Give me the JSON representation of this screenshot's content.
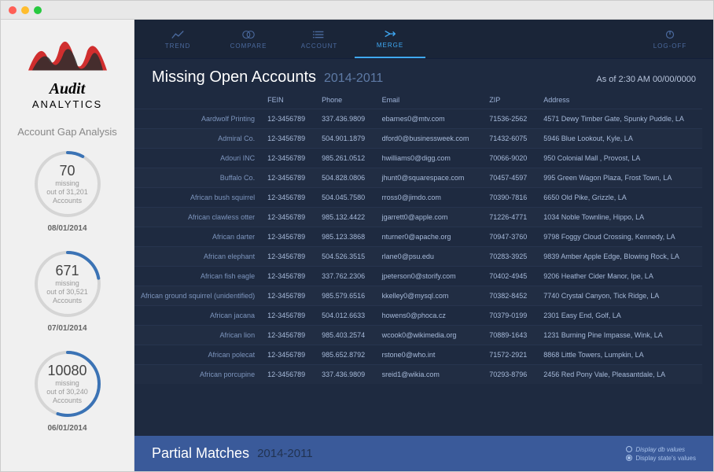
{
  "logo": {
    "line1": "Audit",
    "line2": "ANALYTICS"
  },
  "sidebar": {
    "title": "Account Gap Analysis",
    "gaps": [
      {
        "num": "70",
        "missing": "missing",
        "outof": "out of 31,201",
        "acc": "Accounts",
        "date": "08/01/2014",
        "pct": 8
      },
      {
        "num": "671",
        "missing": "missing",
        "outof": "out of 30,521",
        "acc": "Accounts",
        "date": "07/01/2014",
        "pct": 22
      },
      {
        "num": "10080",
        "missing": "missing",
        "outof": "out of 30,240",
        "acc": "Accounts",
        "date": "06/01/2014",
        "pct": 55
      }
    ]
  },
  "nav": {
    "items": [
      {
        "label": "TREND"
      },
      {
        "label": "COMPARE"
      },
      {
        "label": "ACCOUNT"
      },
      {
        "label": "MERGE"
      }
    ],
    "logoff": "LOG-OFF"
  },
  "header": {
    "title": "Missing Open Accounts",
    "years": "2014-2011",
    "asof": "As of 2:30 AM 00/00/0000"
  },
  "columns": [
    "",
    "FEIN",
    "Phone",
    "Email",
    "ZIP",
    "Address"
  ],
  "rows": [
    {
      "name": "Aardwolf Printing",
      "fein": "12-3456789",
      "phone": "337.436.9809",
      "email": "ebarnes0@mtv.com",
      "zip": "71536-2562",
      "addr": "4571 Dewy Timber Gate, Spunky Puddle, LA"
    },
    {
      "name": "Admiral Co.",
      "fein": "12-3456789",
      "phone": "504.901.1879",
      "email": "dford0@businessweek.com",
      "zip": "71432-6075",
      "addr": "5946 Blue Lookout, Kyle, LA"
    },
    {
      "name": "Adouri INC",
      "fein": "12-3456789",
      "phone": "985.261.0512",
      "email": "hwilliams0@digg.com",
      "zip": "70066-9020",
      "addr": "950 Colonial Mall , Provost, LA"
    },
    {
      "name": "Buffalo  Co.",
      "fein": "12-3456789",
      "phone": "504.828.0806",
      "email": "jhunt0@squarespace.com",
      "zip": "70457-4597",
      "addr": "995 Green Wagon Plaza, Frost Town, LA"
    },
    {
      "name": "African bush squirrel",
      "fein": "12-3456789",
      "phone": "504.045.7580",
      "email": "rross0@jimdo.com",
      "zip": "70390-7816",
      "addr": "6650 Old Pike, Grizzle, LA"
    },
    {
      "name": "African clawless otter",
      "fein": "12-3456789",
      "phone": "985.132.4422",
      "email": "jgarrett0@apple.com",
      "zip": "71226-4771",
      "addr": "1034 Noble Townline, Hippo, LA"
    },
    {
      "name": "African darter",
      "fein": "12-3456789",
      "phone": "985.123.3868",
      "email": "nturner0@apache.org",
      "zip": "70947-3760",
      "addr": "9798 Foggy Cloud Crossing, Kennedy, LA"
    },
    {
      "name": "African elephant",
      "fein": "12-3456789",
      "phone": "504.526.3515",
      "email": "rlane0@psu.edu",
      "zip": "70283-3925",
      "addr": "9839 Amber Apple Edge, Blowing Rock, LA"
    },
    {
      "name": "African fish eagle",
      "fein": "12-3456789",
      "phone": "337.762.2306",
      "email": "jpeterson0@storify.com",
      "zip": "70402-4945",
      "addr": "9206 Heather Cider Manor, Ipe, LA"
    },
    {
      "name": "African ground squirrel (unidentified)",
      "fein": "12-3456789",
      "phone": "985.579.6516",
      "email": "kkelley0@mysql.com",
      "zip": "70382-8452",
      "addr": "7740 Crystal Canyon, Tick Ridge, LA"
    },
    {
      "name": "African jacana",
      "fein": "12-3456789",
      "phone": "504.012.6633",
      "email": "howens0@phoca.cz",
      "zip": "70379-0199",
      "addr": "2301 Easy End, Golf, LA"
    },
    {
      "name": "African lion",
      "fein": "12-3456789",
      "phone": "985.403.2574",
      "email": "wcook0@wikimedia.org",
      "zip": "70889-1643",
      "addr": "1231 Burning Pine Impasse, Wink, LA"
    },
    {
      "name": "African polecat",
      "fein": "12-3456789",
      "phone": "985.652.8792",
      "email": "rstone0@who.int",
      "zip": "71572-2921",
      "addr": "8868 Little Towers, Lumpkin, LA"
    },
    {
      "name": "African porcupine",
      "fein": "12-3456789",
      "phone": "337.436.9809",
      "email": "sreid1@wikia.com",
      "zip": "70293-8796",
      "addr": "2456 Red Pony Vale, Pleasantdale, LA"
    }
  ],
  "partial": {
    "title": "Partial Matches",
    "years": "2014-2011",
    "opt1": "Display db values",
    "opt2": "Display state's values"
  }
}
